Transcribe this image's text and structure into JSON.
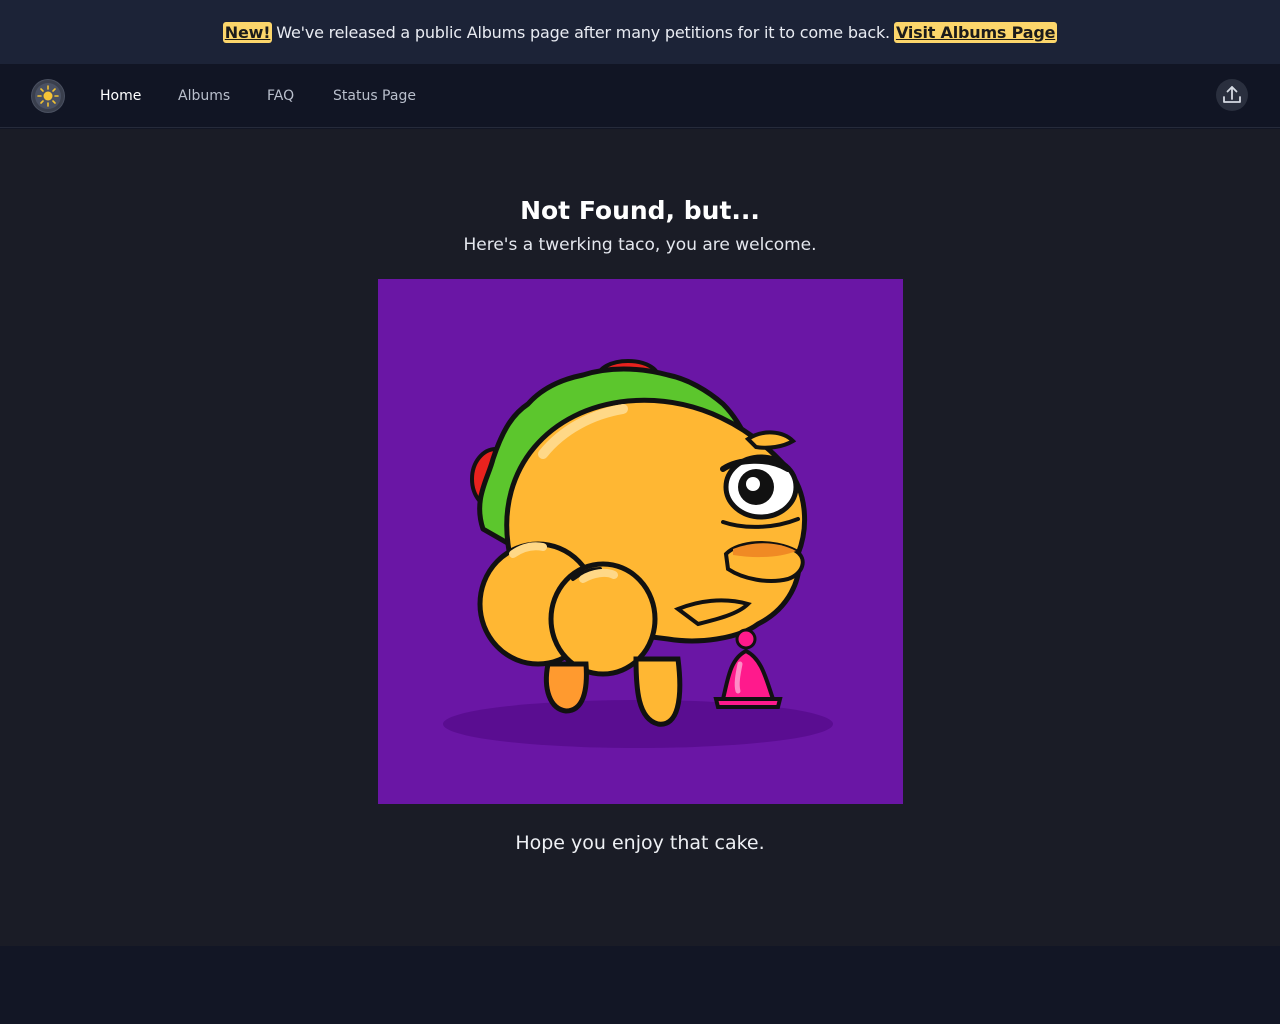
{
  "banner": {
    "badge": "New!",
    "message": "We've released a public Albums page after many petitions for it to come back.",
    "link": "Visit Albums Page"
  },
  "nav": {
    "items": [
      {
        "label": "Home",
        "active": true
      },
      {
        "label": "Albums",
        "active": false
      },
      {
        "label": "FAQ",
        "active": false
      },
      {
        "label": "Status Page",
        "active": false
      }
    ],
    "upload_icon": "upload-icon",
    "logo_icon": "sun-logo-icon"
  },
  "main": {
    "title": "Not Found, but...",
    "subtitle": "Here's a twerking taco, you are welcome.",
    "caption": "Hope you enjoy that cake."
  },
  "colors": {
    "banner_bg": "#1c2337",
    "nav_bg": "#111524",
    "main_bg": "#1a1c26",
    "badge": "#fcd66b",
    "image_bg": "#6a16a5",
    "taco": "#ffb733"
  }
}
